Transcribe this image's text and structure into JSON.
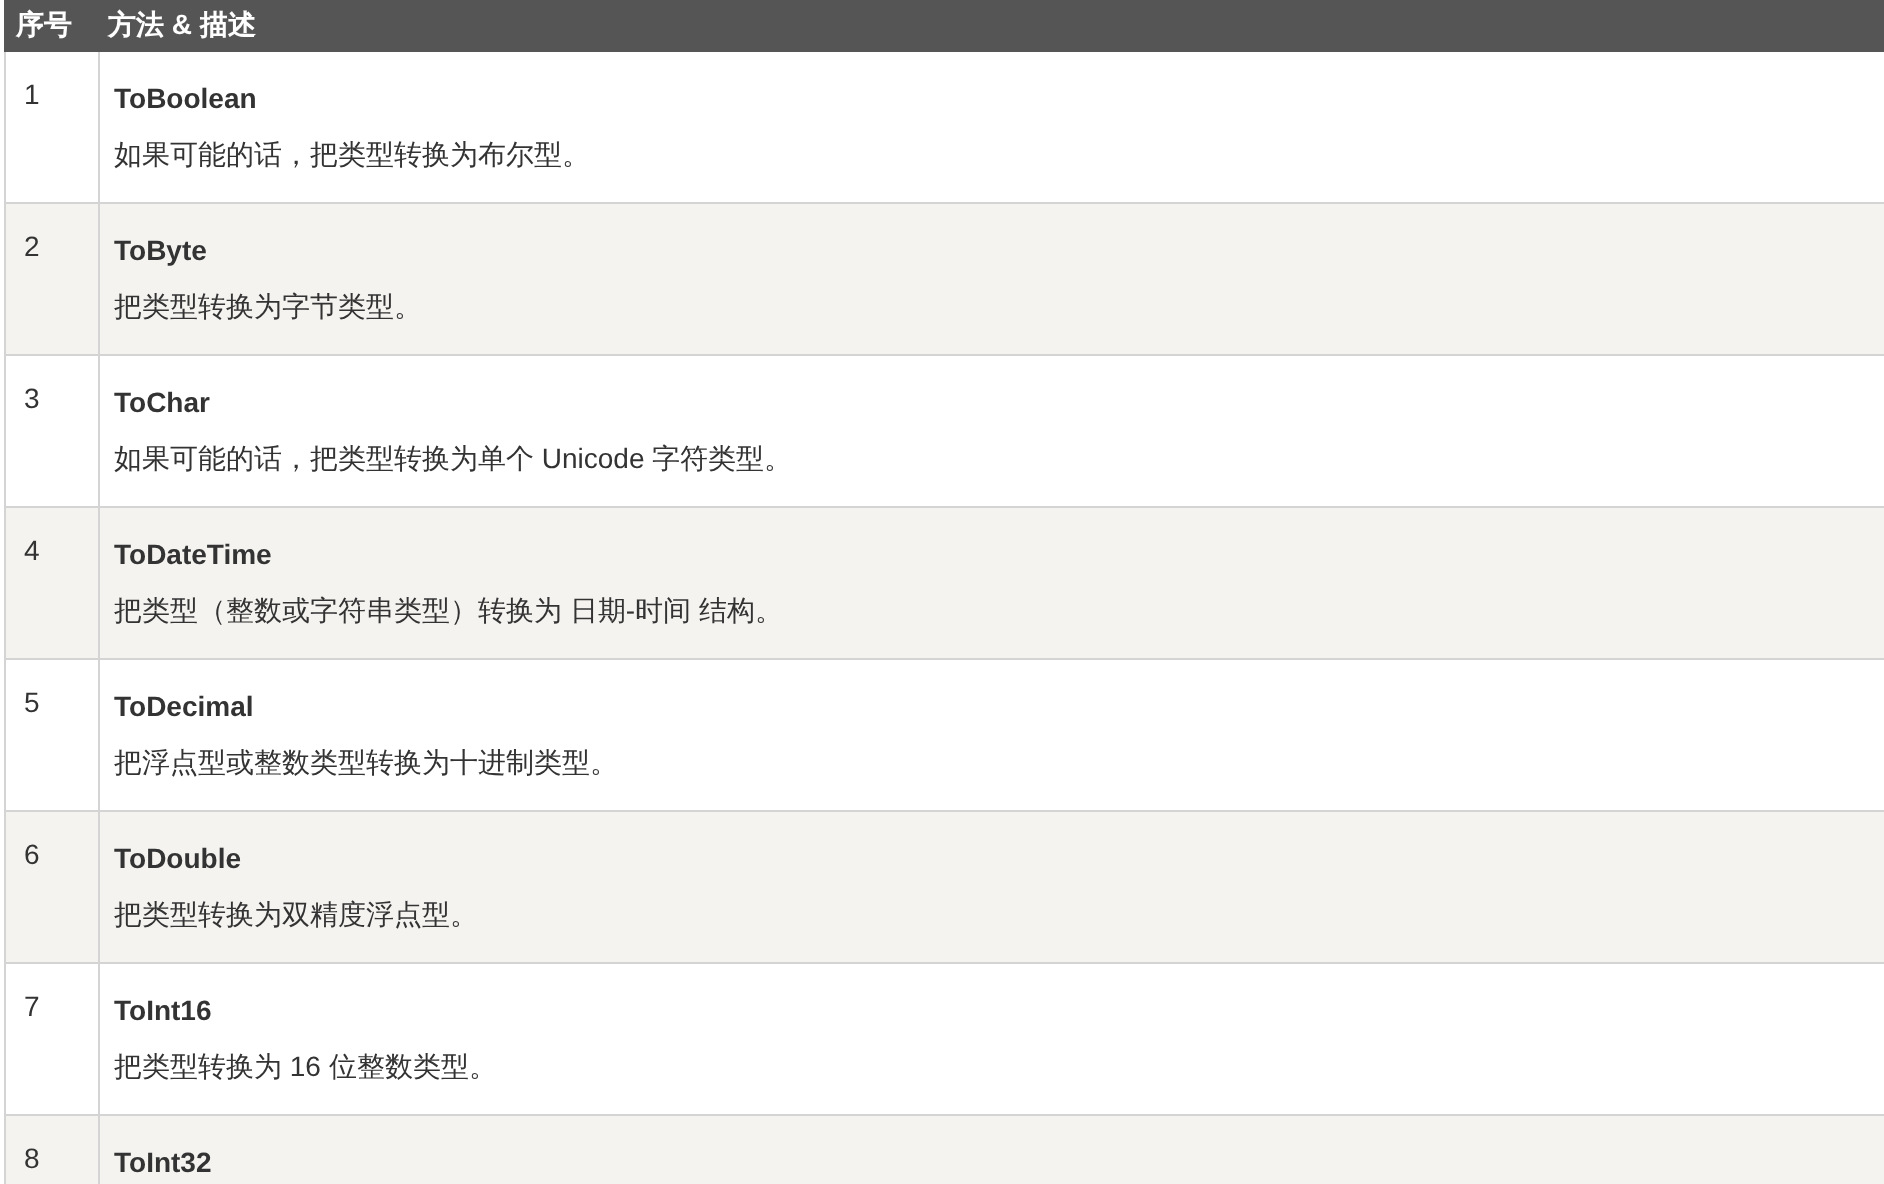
{
  "table": {
    "columns": [
      "序号",
      "方法 & 描述"
    ],
    "rows": [
      {
        "index": "1",
        "method": "ToBoolean",
        "description": "如果可能的话，把类型转换为布尔型。"
      },
      {
        "index": "2",
        "method": "ToByte",
        "description": "把类型转换为字节类型。"
      },
      {
        "index": "3",
        "method": "ToChar",
        "description": "如果可能的话，把类型转换为单个 Unicode 字符类型。"
      },
      {
        "index": "4",
        "method": "ToDateTime",
        "description": "把类型（整数或字符串类型）转换为 日期-时间 结构。"
      },
      {
        "index": "5",
        "method": "ToDecimal",
        "description": "把浮点型或整数类型转换为十进制类型。"
      },
      {
        "index": "6",
        "method": "ToDouble",
        "description": "把类型转换为双精度浮点型。"
      },
      {
        "index": "7",
        "method": "ToInt16",
        "description": "把类型转换为 16 位整数类型。"
      },
      {
        "index": "8",
        "method": "ToInt32"
      }
    ]
  }
}
